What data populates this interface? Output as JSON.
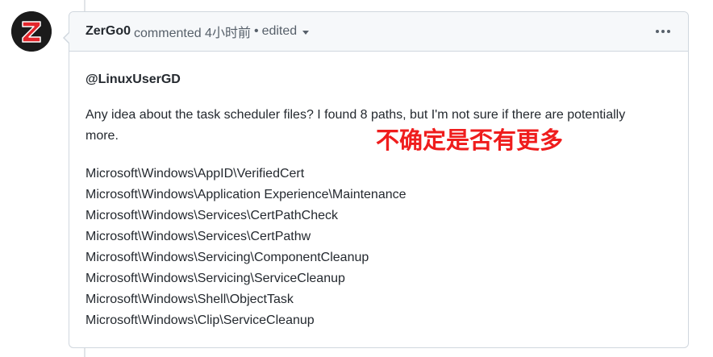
{
  "author": {
    "name": "ZerGo0",
    "avatar_letter": "Z",
    "avatar_color": "#e3262b"
  },
  "header": {
    "action": "commented 4小时前",
    "separator": "•",
    "edited_label": "edited"
  },
  "comment": {
    "mention": "@LinuxUserGD",
    "paragraph": "Any idea about the task scheduler files? I found 8 paths, but I'm not sure if there are potentially more.",
    "annotation": "不确定是否有更多",
    "paths": [
      "Microsoft\\Windows\\AppID\\VerifiedCert",
      "Microsoft\\Windows\\Application Experience\\Maintenance",
      "Microsoft\\Windows\\Services\\CertPathCheck",
      "Microsoft\\Windows\\Services\\CertPathw",
      "Microsoft\\Windows\\Servicing\\ComponentCleanup",
      "Microsoft\\Windows\\Servicing\\ServiceCleanup",
      "Microsoft\\Windows\\Shell\\ObjectTask",
      "Microsoft\\Windows\\Clip\\ServiceCleanup"
    ]
  },
  "colors": {
    "annotation": "#ef1d1d",
    "header_bg": "#f6f8fa",
    "border": "#d0d7de"
  },
  "icons": {
    "menu": "kebab-horizontal-icon",
    "dropdown": "caret-down-icon"
  }
}
